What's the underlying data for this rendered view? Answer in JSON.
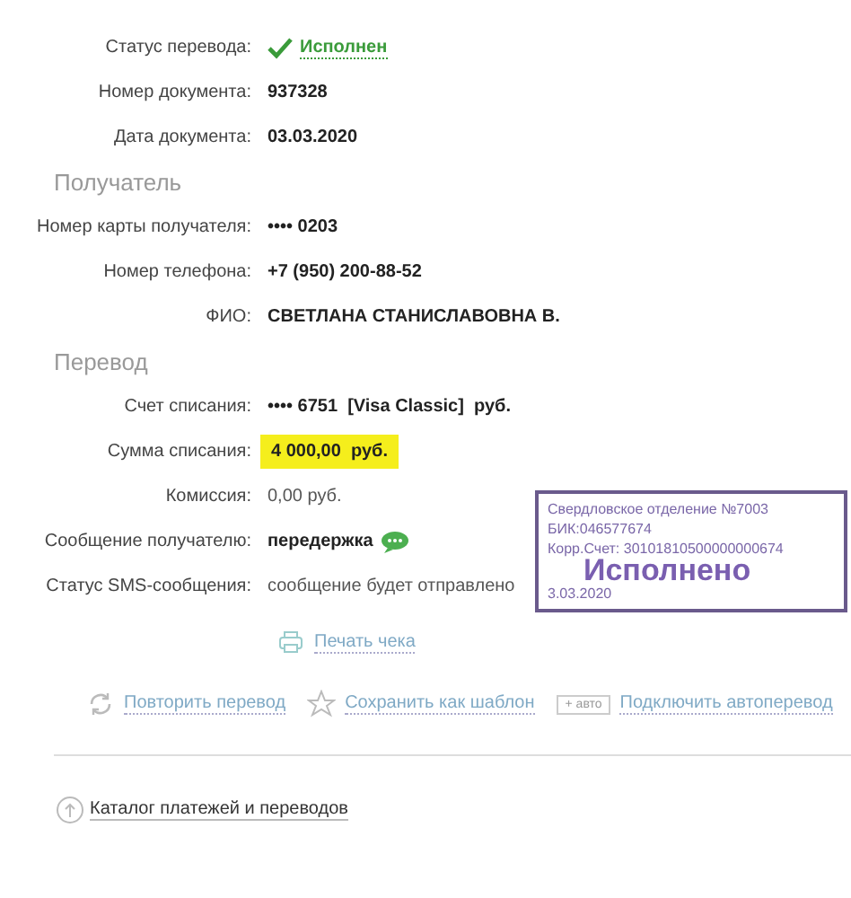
{
  "sections": [
    {
      "rows": [
        {
          "label": "Статус перевода:",
          "value": "Исполнен",
          "kind": "status"
        },
        {
          "label": "Номер документа:",
          "value": "937328",
          "kind": "bold"
        },
        {
          "label": "Дата документа:",
          "value": "03.03.2020",
          "kind": "bold"
        }
      ]
    },
    {
      "title": "Получатель",
      "rows": [
        {
          "label": "Номер карты получателя:",
          "value": "•••• 0203",
          "kind": "bold"
        },
        {
          "label": "Номер телефона:",
          "value": "+7 (950) 200-88-52",
          "kind": "bold"
        },
        {
          "label": "ФИО:",
          "value": "СВЕТЛАНА СТАНИСЛАВОВНА В.",
          "kind": "bold"
        }
      ]
    },
    {
      "title": "Перевод",
      "rows": [
        {
          "label": "Счет списания:",
          "value": "•••• 6751  [Visa Classic]  руб.",
          "kind": "bold"
        },
        {
          "label": "Сумма списания:",
          "value": "4 000,00  руб.",
          "kind": "highlight"
        },
        {
          "label": "Комиссия:",
          "value": "0,00 руб.",
          "kind": "plain"
        },
        {
          "label": "Сообщение получателю:",
          "value": "передержка",
          "kind": "sms"
        },
        {
          "label": "Статус SMS-сообщения:",
          "value": "сообщение будет отправлено",
          "kind": "plain"
        }
      ]
    }
  ],
  "stamp": {
    "lines": [
      "Свердловское отделение №7003",
      "БИК:046577674",
      "Корр.Счет: 30101810500000000674"
    ],
    "status": "Исполнено",
    "date": "3.03.2020"
  },
  "print_link": "Печать чека",
  "actions": [
    {
      "kind": "repeat",
      "label": "Повторить перевод"
    },
    {
      "kind": "template",
      "label": "Сохранить как шаблон"
    },
    {
      "kind": "auto",
      "badge": "+ авто",
      "label": "Подключить автоперевод"
    }
  ],
  "catalog_link": "Каталог платежей и переводов"
}
